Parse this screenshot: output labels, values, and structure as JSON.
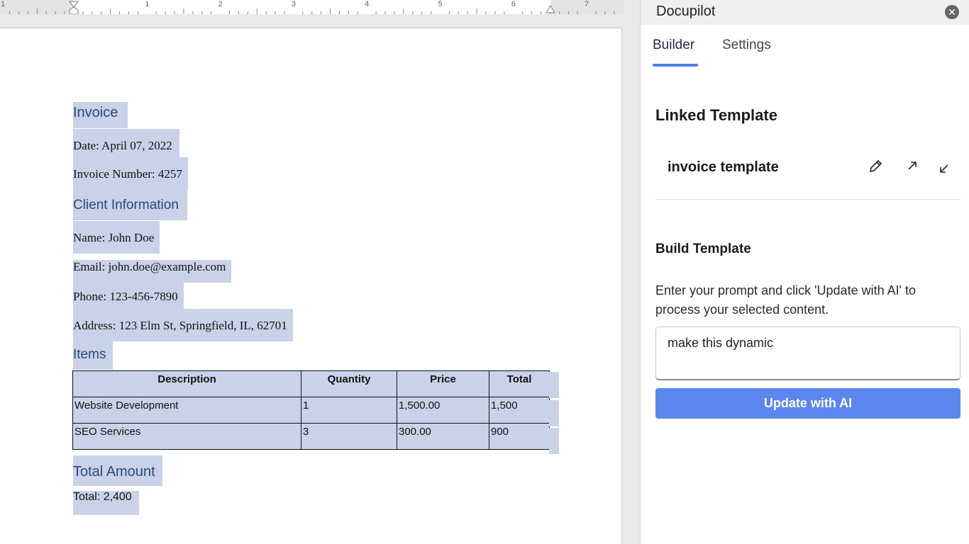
{
  "ruler": {
    "numbers": [
      "1",
      "2",
      "3",
      "4",
      "5",
      "6",
      "7"
    ]
  },
  "document": {
    "title": "Invoice",
    "date": "Date: April 07, 2022",
    "invoice_number": "Invoice Number: 4257",
    "client_heading": "Client Information",
    "name": "Name: John Doe",
    "email": "Email: john.doe@example.com",
    "phone": "Phone: 123-456-7890",
    "address": "Address: 123 Elm St, Springfield, IL, 62701",
    "items_heading": "Items",
    "table": {
      "headers": [
        "Description",
        "Quantity",
        "Price",
        "Total"
      ],
      "rows": [
        [
          "Website Development",
          "1",
          "1,500.00",
          "1,500"
        ],
        [
          "SEO Services",
          "3",
          "300.00",
          "900"
        ]
      ]
    },
    "total_heading": "Total Amount",
    "total": "Total: 2,400"
  },
  "panel": {
    "title": "Docupilot",
    "tabs": [
      {
        "label": "Builder",
        "active": true
      },
      {
        "label": "Settings",
        "active": false
      }
    ],
    "linked_template_title": "Linked Template",
    "template_name": "invoice template",
    "icons": [
      "close-icon",
      "pencil-icon",
      "open-external-icon",
      "unlink-icon"
    ],
    "build_title": "Build Template",
    "build_description": "Enter your prompt and click 'Update with AI' to process your selected content.",
    "prompt_value": "make this dynamic",
    "update_button": "Update with AI",
    "accent_color": "#5b86ee",
    "selection_color": "#c9d2e8",
    "heading_color": "#254a7a"
  }
}
